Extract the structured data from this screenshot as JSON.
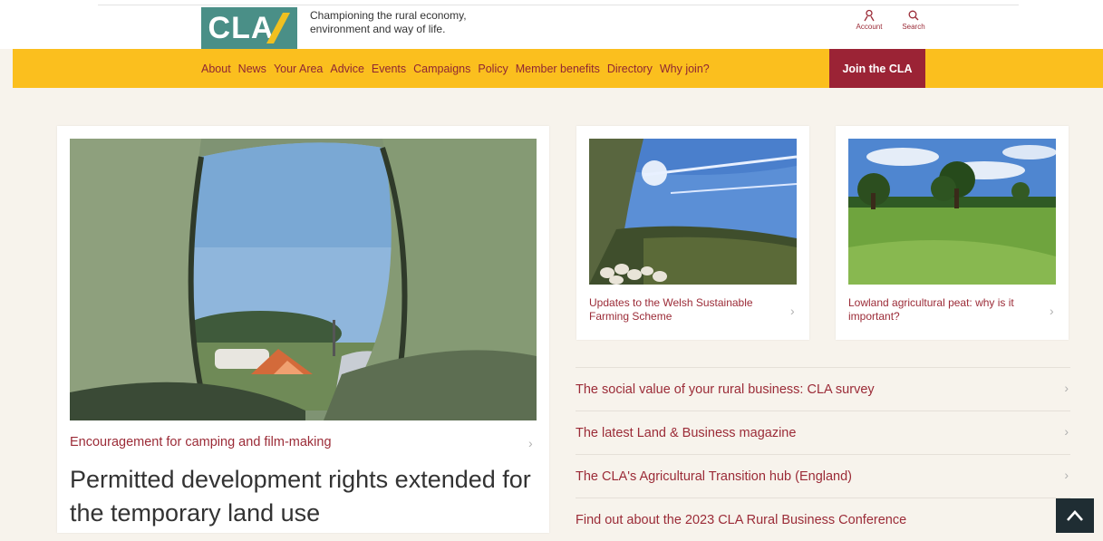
{
  "header": {
    "logo_text": "CLA",
    "tagline_line1": "Championing the rural economy,",
    "tagline_line2": "environment and way of life.",
    "account_label": "Account",
    "search_label": "Search"
  },
  "nav": {
    "items": [
      {
        "label": "About"
      },
      {
        "label": "News"
      },
      {
        "label": "Your Area"
      },
      {
        "label": "Advice"
      },
      {
        "label": "Events"
      },
      {
        "label": "Campaigns"
      },
      {
        "label": "Policy"
      },
      {
        "label": "Member benefits"
      },
      {
        "label": "Directory"
      },
      {
        "label": "Why join?"
      }
    ],
    "join_label": "Join the CLA"
  },
  "featured": {
    "kicker": "Encouragement for camping and film-making",
    "headline": "Permitted development rights extended for the temporary land use"
  },
  "cards": [
    {
      "title": "Updates to the Welsh Sustainable Farming Scheme"
    },
    {
      "title": "Lowland agricultural peat: why is it important?"
    }
  ],
  "links": [
    {
      "label": "The social value of your rural business: CLA survey"
    },
    {
      "label": "The latest Land & Business magazine"
    },
    {
      "label": "The CLA's Agricultural Transition hub (England)"
    },
    {
      "label": "Find out about the 2023 CLA Rural Business Conference"
    }
  ],
  "colors": {
    "brand_teal": "#4a8f87",
    "nav_yellow": "#fbbf1e",
    "accent_maroon": "#9b2335",
    "page_bg": "#f7f3ec"
  }
}
